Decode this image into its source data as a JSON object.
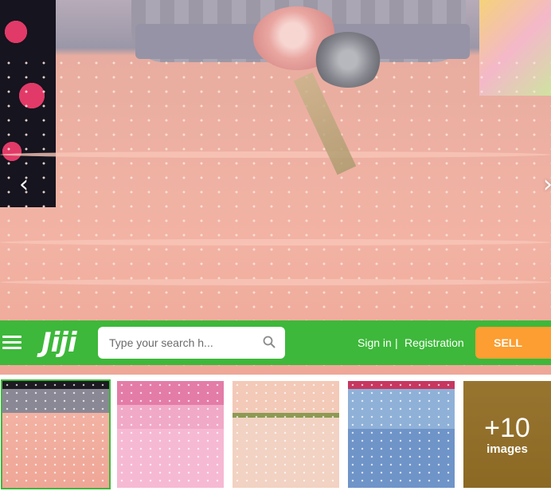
{
  "gallery": {
    "prev_label": "‹",
    "next_label": "›"
  },
  "header": {
    "logo": "Jiji",
    "search_placeholder": "Type your search h...",
    "sign_in": "Sign in",
    "separator": "|",
    "registration": "Registration",
    "sell": "SELL"
  },
  "thumbnails": {
    "more_count": "+10",
    "more_label": "images"
  },
  "colors": {
    "brand_green": "#3db83a",
    "sell_orange": "#fc9e31"
  }
}
